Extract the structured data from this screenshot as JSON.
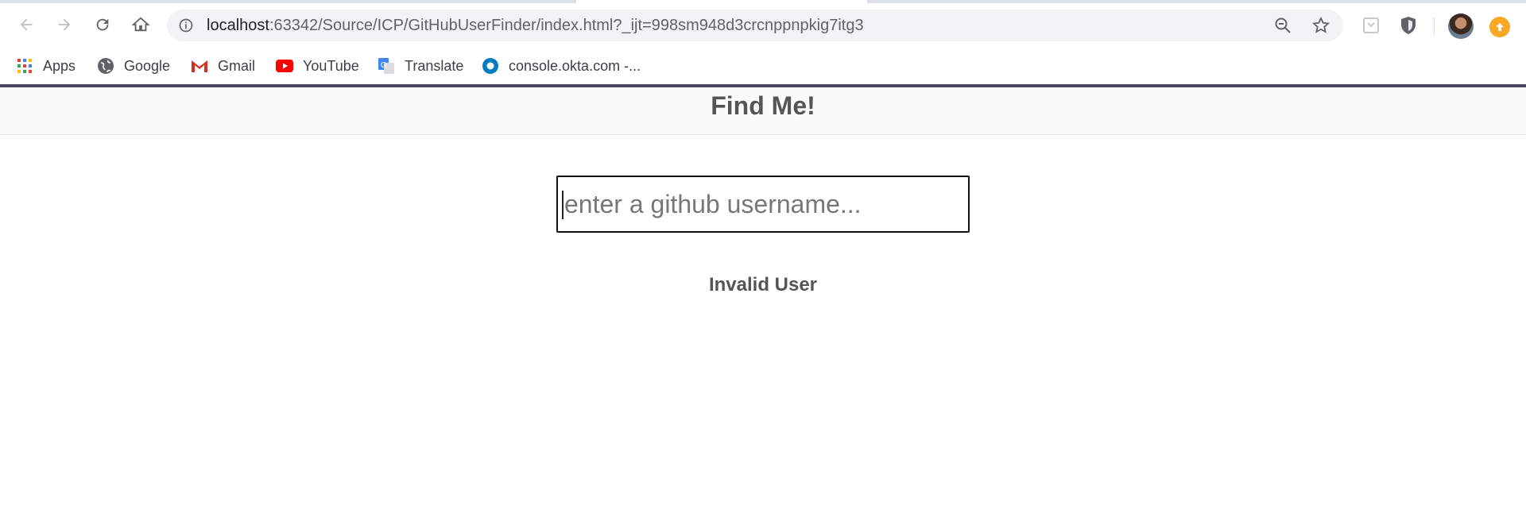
{
  "browser": {
    "url_host": "localhost",
    "url_path": ":63342/Source/ICP/GitHubUserFinder/index.html?_ijt=998sm948d3crcnppnpkig7itg3",
    "bookmarks": [
      {
        "label": "Apps",
        "icon": "apps-grid-icon"
      },
      {
        "label": "Google",
        "icon": "globe-icon"
      },
      {
        "label": "Gmail",
        "icon": "gmail-icon"
      },
      {
        "label": "YouTube",
        "icon": "youtube-icon"
      },
      {
        "label": "Translate",
        "icon": "translate-icon"
      },
      {
        "label": "console.okta.com -...",
        "icon": "okta-icon"
      }
    ],
    "colors": {
      "accent_bar": "#4a4760",
      "update_badge": "#f9a825"
    }
  },
  "page": {
    "title": "Find Me!",
    "search": {
      "placeholder": "enter a github username...",
      "value": ""
    },
    "status": "Invalid User"
  }
}
